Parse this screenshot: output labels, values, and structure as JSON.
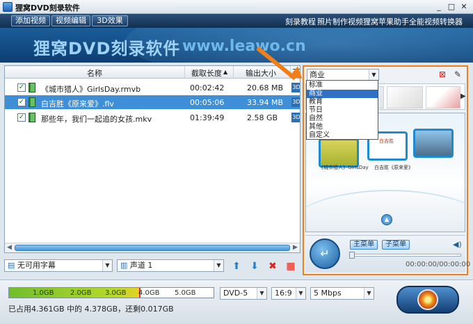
{
  "window": {
    "title": "狸窝DVD刻录软件",
    "controls": {
      "minimize": "_",
      "maximize": "□",
      "close": "✕"
    }
  },
  "menu": {
    "buttons": [
      "添加视频",
      "视频编辑",
      "3D效果"
    ],
    "links": [
      "刻录教程",
      "照片制作视频",
      "狸窝苹果助手",
      "全能视频转换器"
    ]
  },
  "banner": {
    "title": "狸窝DVD刻录软件",
    "url": "www.leawo.cn"
  },
  "file_list": {
    "columns": {
      "name": "名称",
      "duration": "截取长度",
      "size": "输出大小",
      "three_d": "3D"
    },
    "rows": [
      {
        "name": "《城市猎人》GirlsDay.rmvb",
        "duration": "00:02:42",
        "size": "20.68 MB",
        "checked": true,
        "selected": false
      },
      {
        "name": "白吉胜《原来爱》.flv",
        "duration": "00:05:06",
        "size": "33.94 MB",
        "checked": true,
        "selected": true
      },
      {
        "name": "那些年，我们一起追的女孩.mkv",
        "duration": "01:39:49",
        "size": "2.58 GB",
        "checked": true,
        "selected": false
      }
    ],
    "checkmark": "✓",
    "three_d_badge": "3D"
  },
  "bottom_controls": {
    "subtitle": "无可用字幕",
    "audio_track": "声道 1"
  },
  "theme": {
    "selected": "商业",
    "options": [
      "标准",
      "商业",
      "教育",
      "节日",
      "自然",
      "其他",
      "自定义"
    ],
    "active_option": "商业"
  },
  "preview": {
    "frame_labels": [
      "《城市猎人》GirlsDay",
      "白吉胜《原来爱》"
    ],
    "preview_caption": "白吉胜"
  },
  "player": {
    "main_menu": "主菜单",
    "sub_menu": "子菜单",
    "time": "00:00:00/00:00:00"
  },
  "status": {
    "capacity_labels": [
      "1.0GB",
      "2.0GB",
      "3.0GB",
      "4.0GB",
      "5.0GB"
    ],
    "used_fraction": 0.87,
    "usage_text": "已占用4.361GB 中的 4.378GB，还剩0.017GB",
    "disc_type": "DVD-5",
    "aspect": "16:9",
    "bitrate": "5 Mbps"
  },
  "colors": {
    "accent_orange": "#f07f1a",
    "selection_blue": "#3f8ed8",
    "menubar": "#12304f"
  }
}
